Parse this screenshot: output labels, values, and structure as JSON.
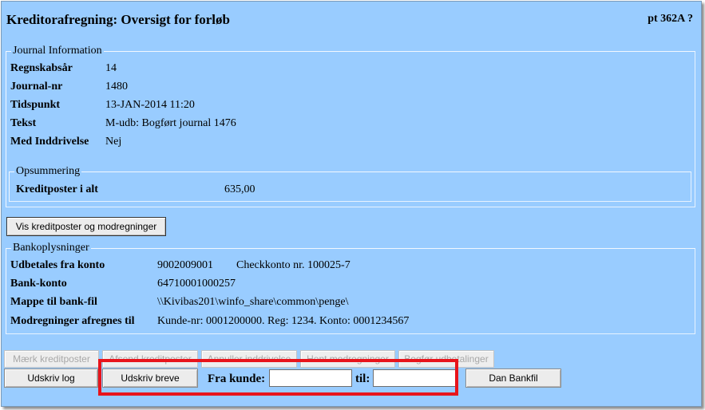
{
  "header": {
    "title": "Kreditorafregning: Oversigt for forløb",
    "page_id": "pt 362A ?"
  },
  "journal": {
    "legend": "Journal Information",
    "rows": [
      {
        "label": "Regnskabsår",
        "value": "14"
      },
      {
        "label": "Journal-nr",
        "value": "1480"
      },
      {
        "label": "Tidspunkt",
        "value": "13-JAN-2014 11:20"
      },
      {
        "label": "Tekst",
        "value": "M-udb: Bogført journal 1476"
      },
      {
        "label": "Med Inddrivelse",
        "value": "Nej"
      }
    ],
    "summary": {
      "legend": "Opsummering",
      "label": "Kreditposter i alt",
      "value": "635,00"
    }
  },
  "show_button_label": "Vis kreditposter og modregninger",
  "bank": {
    "legend": "Bankoplysninger",
    "rows": [
      {
        "label": "Udbetales fra konto",
        "value": "9002009001",
        "extra": "Checkkonto nr. 100025-7"
      },
      {
        "label": "Bank-konto",
        "value": "64710001000257"
      },
      {
        "label": "Mappe til bank-fil",
        "value": "\\\\Kivibas201\\winfo_share\\common\\penge\\"
      },
      {
        "label": "Modregninger afregnes til",
        "value": "Kunde-nr: 0001200000. Reg: 1234. Konto: 0001234567"
      }
    ]
  },
  "actions": {
    "disabled": [
      "Mærk kreditposter",
      "Afsend kreditposter",
      "Annuller inddrivelse",
      "Hent modregninger",
      "Bogfør udbetalinger"
    ],
    "print_log": "Udskriv log",
    "print_letters": "Udskriv breve",
    "from_customer_label": "Fra kunde:",
    "from_customer_value": "",
    "to_label": "til:",
    "to_value": "",
    "bank_file": "Dan Bankfil"
  }
}
